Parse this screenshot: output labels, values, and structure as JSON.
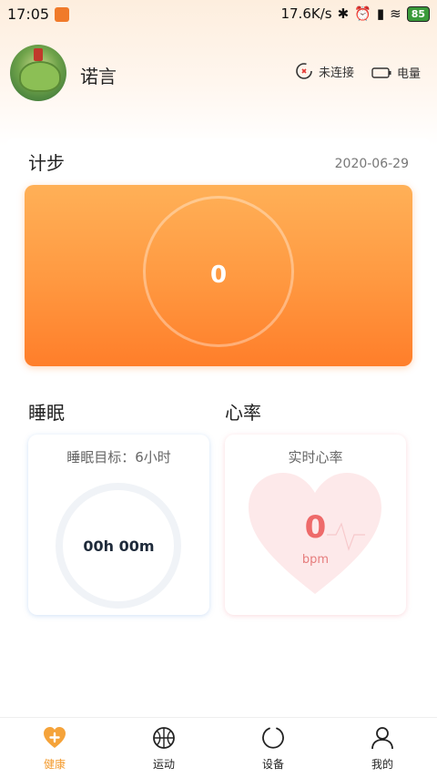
{
  "status_bar": {
    "time": "17:05",
    "speed": "17.6K/s",
    "battery": "85"
  },
  "header": {
    "username": "诺言",
    "connection_label": "未连接",
    "power_label": "电量"
  },
  "steps": {
    "title": "计步",
    "date": "2020-06-29",
    "value": "0"
  },
  "sleep": {
    "title": "睡眠",
    "goal_label": "睡眠目标：6小时",
    "value": "00h 00m"
  },
  "heart": {
    "title": "心率",
    "card_label": "实时心率",
    "value": "0",
    "unit": "bpm"
  },
  "nav": [
    {
      "label": "健康",
      "icon": "health-plus-icon",
      "active": true
    },
    {
      "label": "运动",
      "icon": "basketball-icon",
      "active": false
    },
    {
      "label": "设备",
      "icon": "device-ring-icon",
      "active": false
    },
    {
      "label": "我的",
      "icon": "person-icon",
      "active": false
    }
  ],
  "colors": {
    "accent": "#f39a2c",
    "steps_card_top": "#ffb057",
    "steps_card_bottom": "#ff7e2a",
    "heart": "#ee6a6a"
  }
}
